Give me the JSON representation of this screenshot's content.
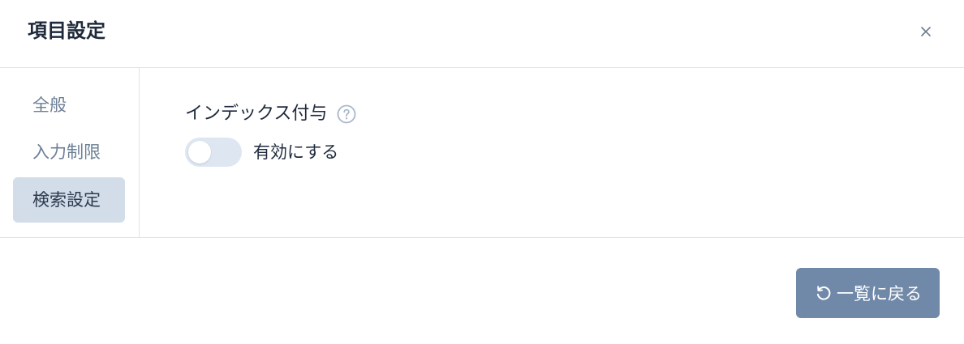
{
  "dialog": {
    "title": "項目設定",
    "close_icon": "close-icon"
  },
  "sidebar": {
    "items": [
      {
        "label": "全般",
        "active": false
      },
      {
        "label": "入力制限",
        "active": false
      },
      {
        "label": "検索設定",
        "active": true
      }
    ]
  },
  "main": {
    "field_label": "インデックス付与",
    "help_icon": "question-circle-icon",
    "toggle": {
      "label": "有効にする",
      "checked": false
    }
  },
  "footer": {
    "back_button_label": "一覧に戻る",
    "back_icon": "undo-icon"
  },
  "colors": {
    "primary_button": "#7189a8",
    "active_nav_bg": "#d3dde9",
    "toggle_track": "#dde6f1",
    "divider": "#dfe3e8"
  }
}
